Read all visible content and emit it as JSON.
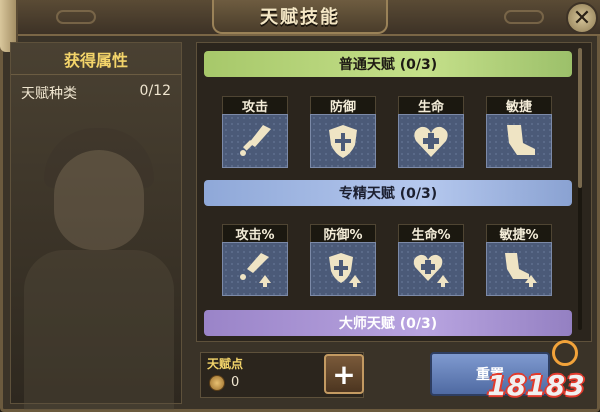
{
  "window": {
    "title": "天赋技能",
    "close_glyph": "✕"
  },
  "left_panel": {
    "header": "获得属性",
    "stat_label": "天赋种类",
    "stat_value": "0/12"
  },
  "sections": [
    {
      "title": "普通天赋 (0/3)",
      "color": "#b5d47c",
      "talents": [
        {
          "label": "攻击",
          "icon": "sword-icon"
        },
        {
          "label": "防御",
          "icon": "shield-icon"
        },
        {
          "label": "生命",
          "icon": "heart-plus-icon"
        },
        {
          "label": "敏捷",
          "icon": "boot-icon"
        }
      ]
    },
    {
      "title": "专精天赋 (0/3)",
      "color": "#a4b9e4",
      "talents": [
        {
          "label": "攻击%",
          "icon": "sword-up-icon"
        },
        {
          "label": "防御%",
          "icon": "shield-up-icon"
        },
        {
          "label": "生命%",
          "icon": "heart-plus-up-icon"
        },
        {
          "label": "敏捷%",
          "icon": "boot-up-icon"
        }
      ]
    },
    {
      "title": "大师天赋 (0/3)",
      "color": "#a894d4",
      "talents": []
    }
  ],
  "footer": {
    "points_label": "天赋点",
    "points_value": "0",
    "add_glyph": "+",
    "reset_label": "重置"
  },
  "watermark": "18183"
}
